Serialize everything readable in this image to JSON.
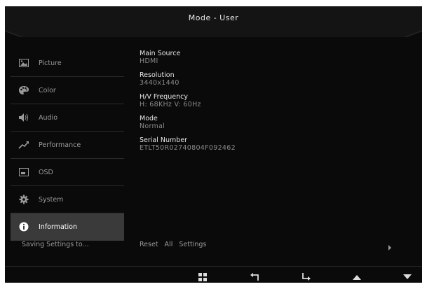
{
  "header": {
    "title": "Mode - User"
  },
  "sidebar": {
    "items": [
      {
        "label": "Picture",
        "icon": "picture-icon"
      },
      {
        "label": "Color",
        "icon": "palette-icon"
      },
      {
        "label": "Audio",
        "icon": "speaker-icon"
      },
      {
        "label": "Performance",
        "icon": "performance-icon"
      },
      {
        "label": "OSD",
        "icon": "osd-icon"
      },
      {
        "label": "System",
        "icon": "gear-icon"
      },
      {
        "label": "Information",
        "icon": "info-icon",
        "active": true
      }
    ],
    "saving_label": "Saving Settings to..."
  },
  "info": {
    "main_source": {
      "label": "Main Source",
      "value": "HDMI"
    },
    "resolution": {
      "label": "Resolution",
      "value": "3440x1440"
    },
    "hv_frequency": {
      "label": "H/V Frequency",
      "value": "H: 68KHz  V: 60Hz"
    },
    "mode": {
      "label": "Mode",
      "value": "Normal"
    },
    "serial_number": {
      "label": "Serial Number",
      "value": "ETLT50R02740804F092462"
    }
  },
  "reset": {
    "label": "Reset  All  Settings"
  },
  "footer": {
    "buttons": [
      "menu-grid-icon",
      "back-icon",
      "enter-icon",
      "up-arrow-icon",
      "down-arrow-icon"
    ]
  },
  "colors": {
    "background": "#0a0a0a",
    "active_item": "#3a3a3a",
    "text_primary": "#e6e6e6",
    "text_secondary": "#8a8a8a"
  }
}
